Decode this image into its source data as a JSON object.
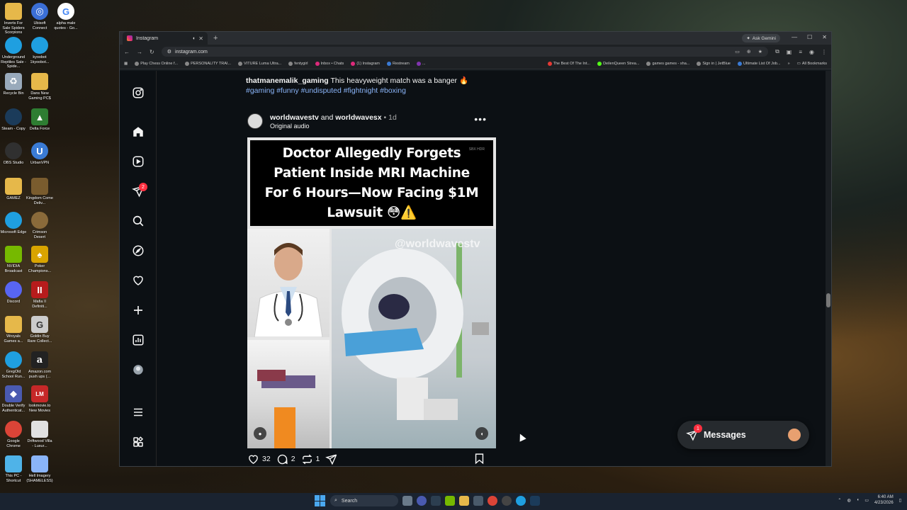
{
  "desktop": {
    "icons": [
      {
        "label": "Inverts For Sale Spiders Scorpions Mantis",
        "icon": "folder-icon",
        "color": "#e6b84a"
      },
      {
        "label": "Ubisoft Connect",
        "icon": "ubisoft-icon",
        "color": "#3b6fd6"
      },
      {
        "label": "alpha male quotes - Go...",
        "icon": "google-icon",
        "color": "#ffffff"
      },
      {
        "label": "Underground Reptiles Sale - Spide...",
        "icon": "edge-icon",
        "color": "#1f9fe0"
      },
      {
        "label": "kyoobot 1kyoobot...",
        "icon": "edge-icon",
        "color": "#1f9fe0"
      },
      {
        "label": "Recycle Bin",
        "icon": "recycle-bin-icon",
        "color": "#9ab"
      },
      {
        "label": "Dans New Gaming PC$",
        "icon": "folder-icon",
        "color": "#e6b84a"
      },
      {
        "label": "Steam - Copy",
        "icon": "steam-icon",
        "color": "#1b3b5a"
      },
      {
        "label": "Delta Force",
        "icon": "delta-force-icon",
        "color": "#2e7d32"
      },
      {
        "label": "OBS Studio",
        "icon": "obs-icon",
        "color": "#303030"
      },
      {
        "label": "UrbanVPN",
        "icon": "vpn-icon",
        "color": "#3a7bd5"
      },
      {
        "label": "GAMEZ",
        "icon": "folder-icon",
        "color": "#e6b84a"
      },
      {
        "label": "Kingdom Come Deliv...",
        "icon": "game-icon",
        "color": "#7a5c2e"
      },
      {
        "label": "Microsoft Edge",
        "icon": "edge-icon",
        "color": "#1f9fe0"
      },
      {
        "label": "Crimson Desert",
        "icon": "game-icon",
        "color": "#8a6a3a"
      },
      {
        "label": "NVIDIA Broadcast",
        "icon": "nvidia-icon",
        "color": "#76b900"
      },
      {
        "label": "Poker Champions...",
        "icon": "poker-icon",
        "color": "#d9a400"
      },
      {
        "label": "Discord",
        "icon": "discord-icon",
        "color": "#5865f2"
      },
      {
        "label": "Mafia II Definiti...",
        "icon": "mafia-icon",
        "color": "#b71c1c"
      },
      {
        "label": "Wroyals Games a...",
        "icon": "folder-icon",
        "color": "#e6b84a"
      },
      {
        "label": "Goldin Buy Rare Collect...",
        "icon": "goldin-icon",
        "color": "#cccccc"
      },
      {
        "label": "GregOld School Run...",
        "icon": "edge-icon",
        "color": "#1f9fe0"
      },
      {
        "label": "Amazon.com push ups (...",
        "icon": "amazon-icon",
        "color": "#222222"
      },
      {
        "label": "Double Verify Authenticat...",
        "icon": "shield-icon",
        "color": "#4a5ab0"
      },
      {
        "label": "lookmovie.to New Movies",
        "icon": "lookmovie-icon",
        "color": "#c62828"
      },
      {
        "label": "Google Chrome",
        "icon": "chrome-icon",
        "color": "#db4437"
      },
      {
        "label": "Driftwood Villa - Luxur...",
        "icon": "document-icon",
        "color": "#e0e0e0"
      },
      {
        "label": "This PC - Shortcut",
        "icon": "computer-icon",
        "color": "#4fb3e8"
      },
      {
        "label": "Hell Imagery (SHAMELESS)",
        "icon": "image-icon",
        "color": "#8ab4f8"
      }
    ]
  },
  "browser": {
    "tab_title": "Instagram",
    "new_tab": "+",
    "ask_gemini": "Ask Gemini",
    "url": "instagram.com",
    "bookmarks": [
      "Play Chess Online f...",
      "PERSONALITY TRAI...",
      "VITURE Luma Ultra...",
      "fentygirl",
      "Inbox • Chats",
      "(1) Instagram",
      "Restream",
      "...",
      "The Best Of The Int...",
      "DeilenQueen Strea...",
      "games games - sha...",
      "Sign in | JetBlue",
      "Ultimate List Of Job..."
    ],
    "all_bookmarks": "All Bookmarks"
  },
  "instagram": {
    "notifications_badge": "2",
    "prev_caption": {
      "username": "thatmanemalik_gaming",
      "text": "This heavyweight match was a banger 🔥",
      "hashtags": "#gaming #funny #undisputed #fightnight #boxing"
    },
    "post": {
      "user1": "worldwavestv",
      "joiner": "and",
      "user2": "worldwavesx",
      "separator": "•",
      "time": "1d",
      "audio": "Original audio",
      "more": "•••",
      "headline": "Doctor Allegedly Forgets Patient Inside MRI Machine For 6 Hours—Now Facing $1M Lawsuit 😳⚠️",
      "watermark": "@worldwavestv",
      "corner_logo": "SBX HDR",
      "likes": "32",
      "comments": "2",
      "reposts": "1"
    },
    "messages": {
      "label": "Messages",
      "badge": "1"
    }
  },
  "taskbar": {
    "search_placeholder": "Search",
    "time": "6:40 AM",
    "date": "4/23/2026"
  }
}
